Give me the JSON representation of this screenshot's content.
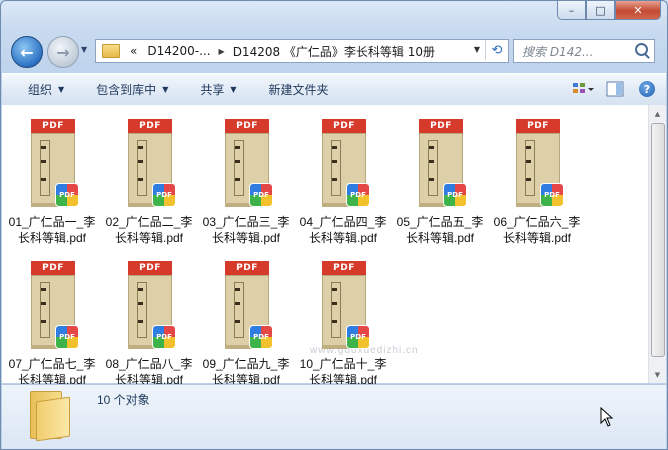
{
  "window": {
    "caption_buttons": {
      "minimize": "–",
      "maximize": "□",
      "close": "✕"
    }
  },
  "nav": {
    "back_icon": "arrow-left-icon",
    "forward_icon": "arrow-right-icon",
    "breadcrumb_prefix": "«",
    "crumbs": [
      "D14200-...",
      "D14208 《广仁品》李长科等辑 10册"
    ],
    "search_placeholder": "搜索 D142..."
  },
  "toolbar": {
    "organize": "组织",
    "include_in_library": "包含到库中",
    "share": "共享",
    "new_folder": "新建文件夹"
  },
  "files": [
    {
      "line1": "01_广仁品一_李",
      "line2": "长科等辑.pdf"
    },
    {
      "line1": "02_广仁品二_李",
      "line2": "长科等辑.pdf"
    },
    {
      "line1": "03_广仁品三_李",
      "line2": "长科等辑.pdf"
    },
    {
      "line1": "04_广仁品四_李",
      "line2": "长科等辑.pdf"
    },
    {
      "line1": "05_广仁品五_李",
      "line2": "长科等辑.pdf"
    },
    {
      "line1": "06_广仁品六_李",
      "line2": "长科等辑.pdf"
    },
    {
      "line1": "07_广仁品七_李",
      "line2": "长科等辑.pdf"
    },
    {
      "line1": "08_广仁品八_李",
      "line2": "长科等辑.pdf"
    },
    {
      "line1": "09_广仁品九_李",
      "line2": "长科等辑.pdf"
    },
    {
      "line1": "10_广仁品十_李",
      "line2": "长科等辑.pdf"
    }
  ],
  "thumbnail": {
    "band_label": "PDF",
    "badge_label": "PDF",
    "band_color": "#d63a2a"
  },
  "watermark": "www.guoxuedizhi.cn",
  "status": {
    "count_text": "10 个对象"
  }
}
